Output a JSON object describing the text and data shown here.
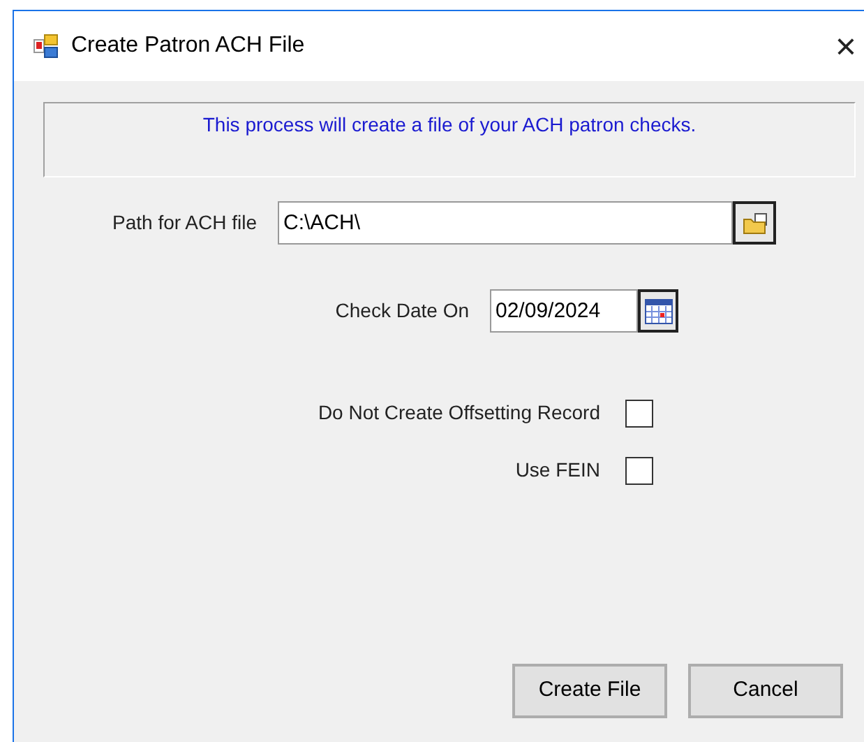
{
  "window": {
    "title": "Create Patron ACH File",
    "close": "×"
  },
  "message": "This process will create a file of your ACH patron checks.",
  "path_field": {
    "label": "Path for ACH file",
    "value": "C:\\ACH\\"
  },
  "date_field": {
    "label": "Check Date On",
    "value": "02/09/2024"
  },
  "options": [
    {
      "label": "Do Not Create Offsetting Record",
      "checked": false
    },
    {
      "label": "Use FEIN",
      "checked": false
    }
  ],
  "buttons": [
    "Create File",
    "Cancel"
  ]
}
